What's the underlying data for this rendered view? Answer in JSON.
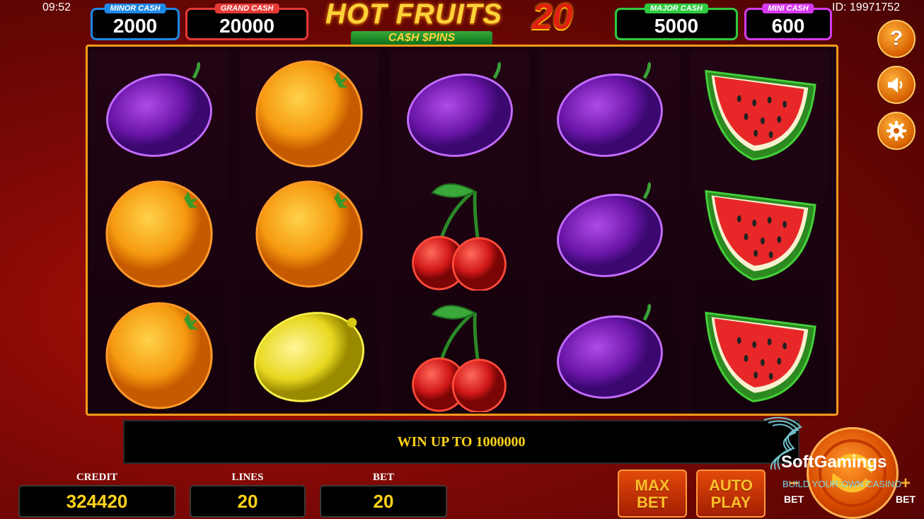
{
  "status": {
    "time": "09:52",
    "game_id": "ID: 19971752"
  },
  "jackpots": [
    {
      "label": "MINOR CASH",
      "value": "2000",
      "color": "#1e88e5"
    },
    {
      "label": "GRAND CASH",
      "value": "20000",
      "color": "#e53935"
    },
    {
      "label": "MAJOR CASH",
      "value": "5000",
      "color": "#2ecc40"
    },
    {
      "label": "MINI CASH",
      "value": "600",
      "color": "#d63af0"
    }
  ],
  "logo": {
    "title": "HOT FRUITS",
    "number": "20",
    "subtitle": "CA$H $PINS"
  },
  "reels": [
    [
      "plum",
      "orange",
      "orange"
    ],
    [
      "orange",
      "orange",
      "lemon"
    ],
    [
      "plum",
      "cherries",
      "cherries"
    ],
    [
      "plum",
      "plum",
      "plum"
    ],
    [
      "watermelon",
      "watermelon",
      "watermelon"
    ]
  ],
  "side_buttons": {
    "help": "help-icon",
    "sound": "speaker-icon",
    "settings": "gear-icon"
  },
  "win_message": "WIN UP TO 1000000",
  "credit": {
    "label": "CREDIT",
    "value": "324420"
  },
  "lines": {
    "label": "LINES",
    "value": "20"
  },
  "bet": {
    "label": "BET",
    "value": "20"
  },
  "buttons": {
    "max_bet_line1": "MAX",
    "max_bet_line2": "BET",
    "auto_play_line1": "AUTO",
    "auto_play_line2": "PLAY",
    "bet_minus": "BET",
    "bet_plus": "BET"
  },
  "watermark": {
    "name": "SoftGamings",
    "tagline": "BUILD YOUR OWN CASINO"
  }
}
